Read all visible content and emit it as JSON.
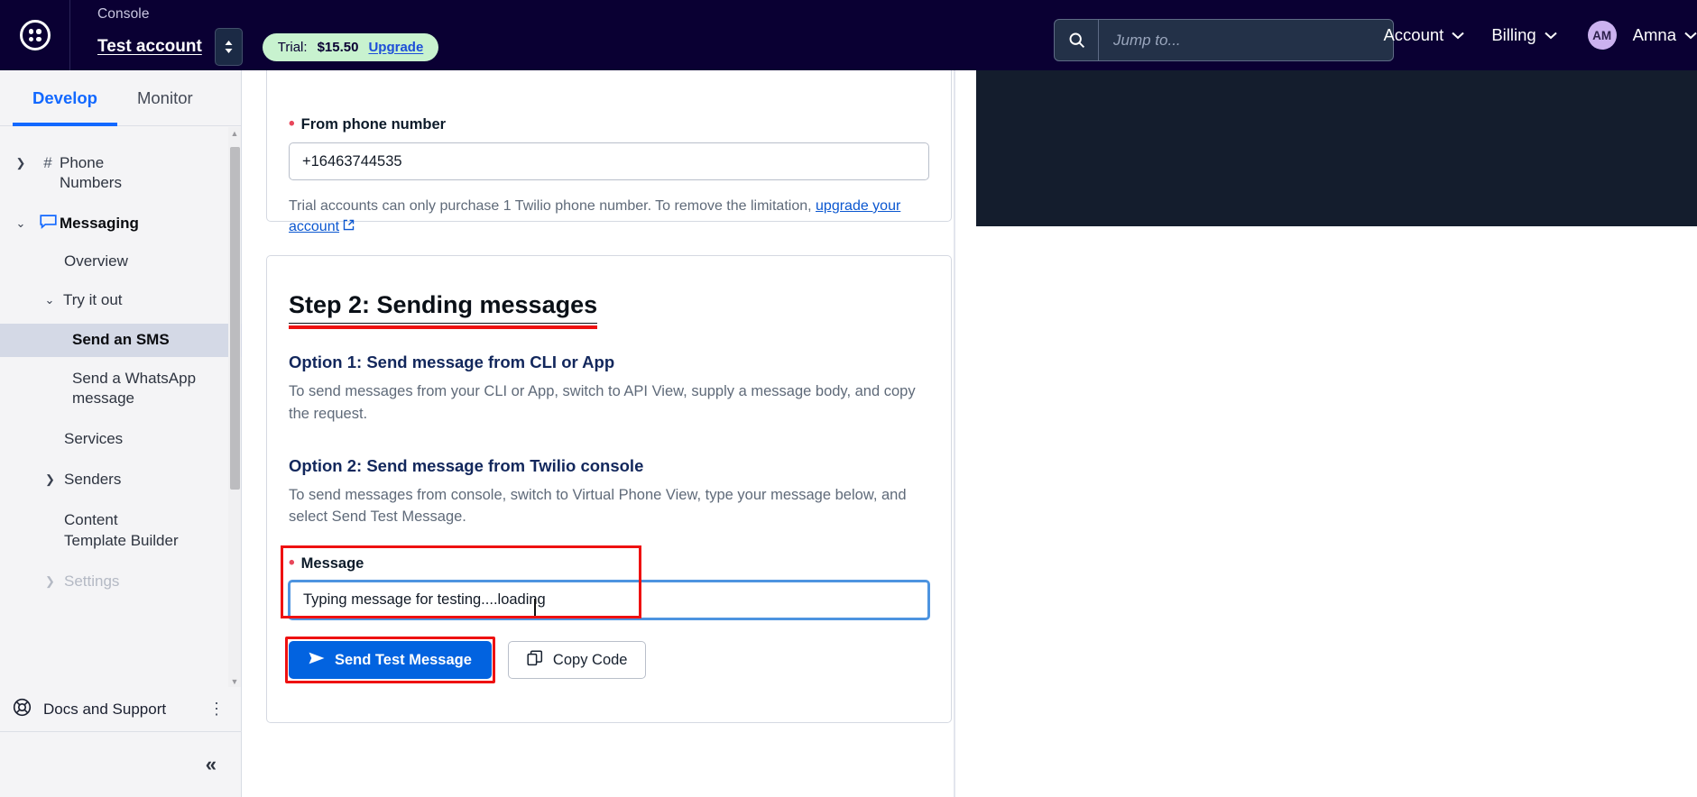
{
  "topbar": {
    "logo_name": "twilio-logo",
    "console_label": "Console",
    "account_name": "Test account",
    "account_switcher_icon": "up-down-chevron-icon",
    "trial": {
      "label": "Trial:",
      "amount": "$15.50",
      "upgrade_label": "Upgrade"
    },
    "search": {
      "icon": "search-icon",
      "placeholder": "Jump to...",
      "value": ""
    },
    "nav": [
      {
        "label": "Account",
        "icon": "chevron-down-icon"
      },
      {
        "label": "Billing",
        "icon": "chevron-down-icon"
      }
    ],
    "user": {
      "initials": "AM",
      "name": "Amna",
      "icon": "chevron-down-icon"
    }
  },
  "sidebar": {
    "tabs": [
      {
        "label": "Develop",
        "active": true
      },
      {
        "label": "Monitor",
        "active": false
      }
    ],
    "items": [
      {
        "label": "Phone Numbers",
        "chevron": "chevron-right-icon",
        "icon": "hash-icon",
        "level": 0,
        "bold": false,
        "selected": false,
        "muted": false
      },
      {
        "label": "Messaging",
        "chevron": "chevron-down-icon",
        "icon": "chat-bubble-icon",
        "level": 0,
        "bold": true,
        "selected": false,
        "muted": false
      },
      {
        "label": "Overview",
        "chevron": "",
        "icon": "",
        "level": 1,
        "bold": false,
        "selected": false,
        "muted": false
      },
      {
        "label": "Try it out",
        "chevron": "chevron-down-icon",
        "icon": "",
        "level": 1,
        "bold": false,
        "selected": false,
        "muted": false
      },
      {
        "label": "Send an SMS",
        "chevron": "",
        "icon": "",
        "level": 2,
        "bold": true,
        "selected": true,
        "muted": false
      },
      {
        "label": "Send a WhatsApp message",
        "chevron": "",
        "icon": "",
        "level": 2,
        "bold": false,
        "selected": false,
        "muted": false
      },
      {
        "label": "Services",
        "chevron": "",
        "icon": "",
        "level": 1,
        "bold": false,
        "selected": false,
        "muted": false
      },
      {
        "label": "Senders",
        "chevron": "chevron-right-icon",
        "icon": "",
        "level": 1,
        "bold": false,
        "selected": false,
        "muted": false
      },
      {
        "label": "Content Template Builder",
        "chevron": "",
        "icon": "",
        "level": 1,
        "bold": false,
        "selected": false,
        "muted": false
      },
      {
        "label": "Settings",
        "chevron": "chevron-right-icon",
        "icon": "",
        "level": 1,
        "bold": false,
        "selected": false,
        "muted": true
      }
    ],
    "docs": {
      "icon": "lifebuoy-icon",
      "label": "Docs and Support",
      "kebab_icon": "vertical-dots-icon"
    },
    "collapse": {
      "icon": "double-chevron-left-icon"
    },
    "scrollbar": {
      "up_icon": "scroll-up-arrow-icon",
      "down_icon": "scroll-down-arrow-icon"
    }
  },
  "main": {
    "from_number_card": {
      "label": "From phone number",
      "required_marker": "•",
      "value": "+16463744535",
      "help_prefix": "Trial accounts can only purchase 1 Twilio phone number. To remove the limitation, ",
      "help_link": "upgrade your account",
      "external_link_icon": "external-link-icon"
    },
    "step2_card": {
      "title": "Step 2: Sending messages",
      "option1": {
        "title": "Option 1: Send message from CLI or App",
        "body": "To send messages from your CLI or App, switch to API View, supply a message body, and copy the request."
      },
      "option2": {
        "title": "Option 2: Send message from Twilio console",
        "body": "To send messages from console, switch to Virtual Phone View, type your message below, and select Send Test Message."
      },
      "message_field": {
        "label": "Message",
        "required_marker": "•",
        "value": "Typing message for testing....loading",
        "placeholder": ""
      },
      "send_button": {
        "icon": "paper-plane-icon",
        "label": "Send Test Message"
      },
      "copy_button": {
        "icon": "copy-icon",
        "label": "Copy Code"
      }
    }
  },
  "colors": {
    "brand_navy": "#0a0033",
    "accent_blue": "#0263e0",
    "link_blue": "#0b57d0",
    "annotation_red": "#ee1111",
    "trial_green": "#c8f2cf",
    "dark_panel": "#141d2d",
    "selected_nav": "#d4d9e6"
  }
}
